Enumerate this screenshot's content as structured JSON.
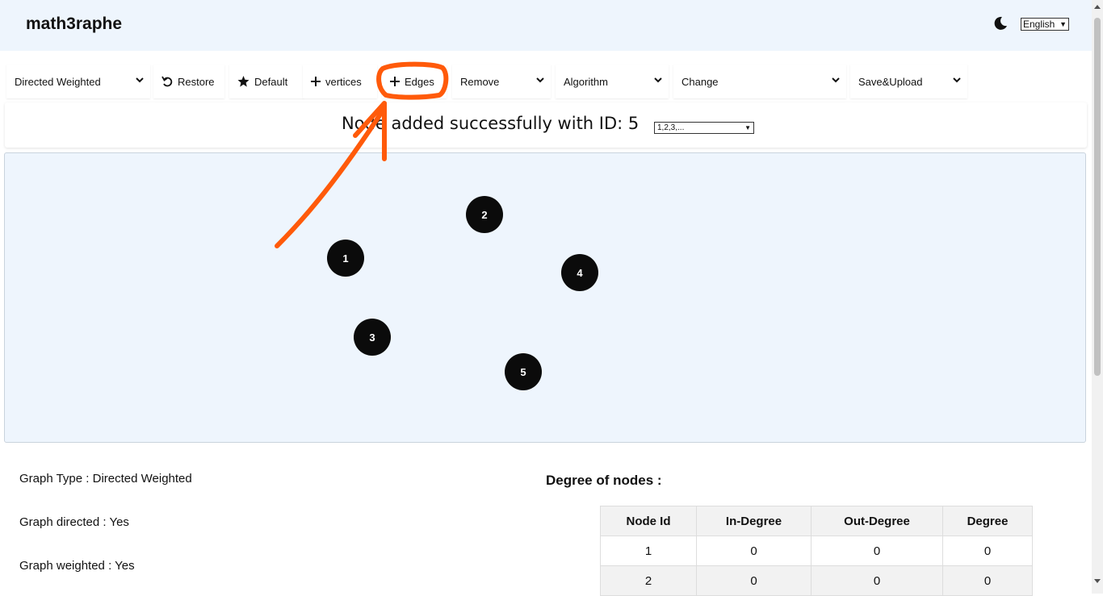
{
  "app": {
    "title": "math3raphe",
    "language": "English"
  },
  "toolbar": {
    "graph_type": "Directed Weighted",
    "restore": "Restore",
    "default": "Default",
    "vertices": "vertices",
    "edges": "Edges",
    "remove": "Remove",
    "algorithm": "Algorithm",
    "change": "Change",
    "save_upload": "Save&Upload"
  },
  "status": {
    "message": "Node added successfully with ID: 5",
    "select_value": "1,2,3,..."
  },
  "graph": {
    "nodes": [
      {
        "id": "1"
      },
      {
        "id": "2"
      },
      {
        "id": "3"
      },
      {
        "id": "4"
      },
      {
        "id": "5"
      }
    ]
  },
  "info": {
    "graph_type": "Graph Type : Directed Weighted",
    "directed": "Graph directed : Yes",
    "weighted": "Graph weighted : Yes"
  },
  "degree": {
    "title": "Degree of nodes :",
    "headers": [
      "Node Id",
      "In-Degree",
      "Out-Degree",
      "Degree"
    ],
    "rows": [
      [
        "1",
        "0",
        "0",
        "0"
      ],
      [
        "2",
        "0",
        "0",
        "0"
      ]
    ]
  },
  "colors": {
    "header_bg": "#eef5fd",
    "canvas_bg": "#eef5fd",
    "node": "#0b0b0b",
    "annotation": "#ff5a0a"
  }
}
